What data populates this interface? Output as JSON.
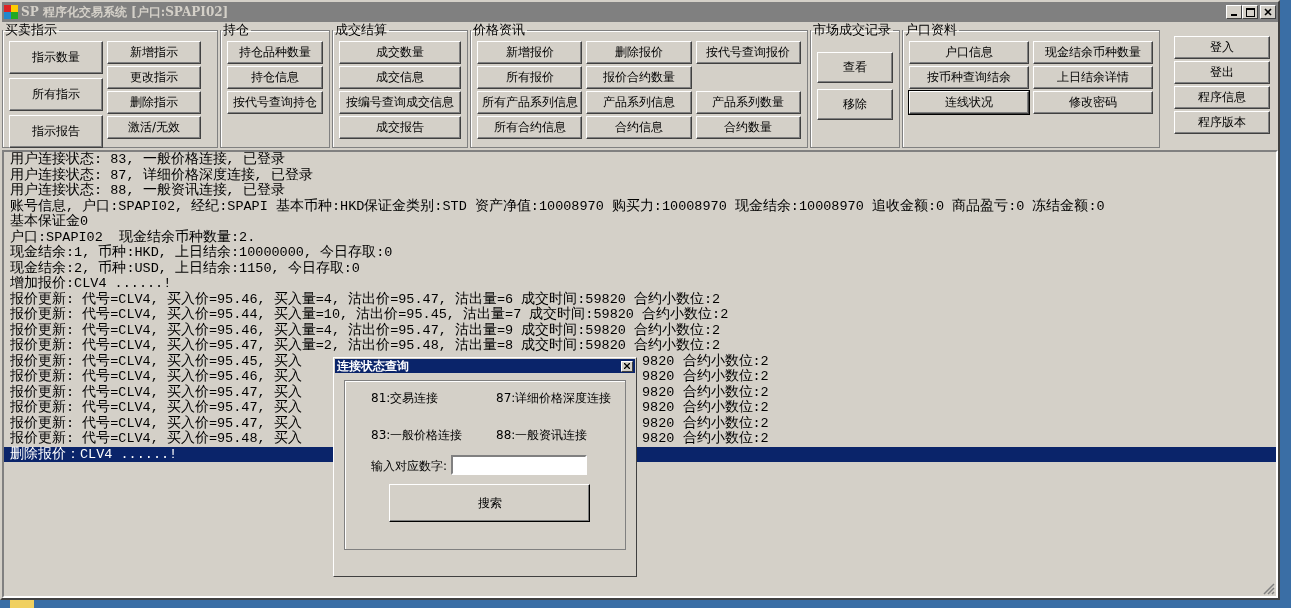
{
  "window": {
    "title": "SP 程序化交易系统 [户口:SPAPI02]"
  },
  "groups": [
    {
      "title": "买卖指示",
      "kind": "columns",
      "columns": [
        [
          {
            "label": "指示数量"
          },
          {
            "label": "所有指示"
          },
          {
            "label": "指示报告"
          }
        ],
        [
          {
            "label": "新增指示"
          },
          {
            "label": "更改指示"
          },
          {
            "label": "删除指示"
          },
          {
            "label": "激活/无效"
          }
        ]
      ]
    },
    {
      "title": "持仓",
      "kind": "rows",
      "rows": [
        [
          {
            "label": "持仓品种数量"
          }
        ],
        [
          {
            "label": "持仓信息"
          }
        ],
        [
          {
            "label": "按代号查询持仓"
          }
        ]
      ]
    },
    {
      "title": "成交结算",
      "kind": "rows",
      "rows": [
        [
          {
            "label": "成交数量"
          }
        ],
        [
          {
            "label": "成交信息"
          }
        ],
        [
          {
            "label": "按编号查询成交信息"
          }
        ],
        [
          {
            "label": "成交报告"
          }
        ]
      ]
    },
    {
      "title": "价格资讯",
      "kind": "rows",
      "rows": [
        [
          {
            "label": "新增报价"
          },
          {
            "label": "删除报价"
          },
          {
            "label": "按代号查询报价"
          }
        ],
        [
          {
            "label": "所有报价"
          },
          {
            "label": "报价合约数量"
          }
        ],
        [
          {
            "label": "所有产品系列信息"
          },
          {
            "label": "产品系列信息"
          },
          {
            "label": "产品系列数量"
          }
        ],
        [
          {
            "label": "所有合约信息"
          },
          {
            "label": "合约信息"
          },
          {
            "label": "合约数量"
          }
        ]
      ]
    },
    {
      "title": "市场成交记录",
      "kind": "tall",
      "rows": [
        [
          {
            "label": "查看"
          }
        ],
        [
          {
            "label": "移除"
          }
        ]
      ]
    },
    {
      "title": "户口资料",
      "kind": "rows",
      "rows": [
        [
          {
            "label": "户口信息",
            "focused": false
          },
          {
            "label": "现金结余币种数量",
            "focused": false
          }
        ],
        [
          {
            "label": "按币种查询结余",
            "focused": false
          },
          {
            "label": "上日结余详情",
            "focused": false
          }
        ],
        [
          {
            "label": "连线状况",
            "focused": true
          },
          {
            "label": "修改密码",
            "focused": false
          }
        ]
      ]
    }
  ],
  "side_buttons": [
    "登入",
    "登出",
    "程序信息",
    "程序版本"
  ],
  "log": [
    {
      "text": "用户连接状态: 83, 一般价格连接, 已登录",
      "selected": false
    },
    {
      "text": "用户连接状态: 87, 详细价格深度连接, 已登录",
      "selected": false
    },
    {
      "text": "用户连接状态: 88, 一般资讯连接, 已登录",
      "selected": false
    },
    {
      "text": "账号信息, 户口:SPAPI02, 经纪:SPAPI 基本币种:HKD保证金类别:STD 资产净值:10008970 购买力:10008970 现金结余:10008970 追收金额:0 商品盈亏:0 冻结金额:0",
      "selected": false
    },
    {
      "text": "基本保证金0",
      "selected": false
    },
    {
      "text": "户口:SPAPI02  现金结余币种数量:2.",
      "selected": false
    },
    {
      "text": "现金结余:1, 币种:HKD, 上日结余:10000000, 今日存取:0",
      "selected": false
    },
    {
      "text": "现金结余:2, 币种:USD, 上日结余:1150, 今日存取:0",
      "selected": false
    },
    {
      "text": "增加报价:CLV4 ......!",
      "selected": false
    },
    {
      "text": "报价更新: 代号=CLV4, 买入价=95.46, 买入量=4, 沽出价=95.47, 沽出量=6 成交时间:59820 合约小数位:2",
      "selected": false
    },
    {
      "text": "报价更新: 代号=CLV4, 买入价=95.44, 买入量=10, 沽出价=95.45, 沽出量=7 成交时间:59820 合约小数位:2",
      "selected": false
    },
    {
      "text": "报价更新: 代号=CLV4, 买入价=95.46, 买入量=4, 沽出价=95.47, 沽出量=9 成交时间:59820 合约小数位:2",
      "selected": false
    },
    {
      "text": "报价更新: 代号=CLV4, 买入价=95.47, 买入量=2, 沽出价=95.48, 沽出量=8 成交时间:59820 合约小数位:2",
      "selected": false
    },
    {
      "text": "报价更新: 代号=CLV4, 买入价=95.45, 买入",
      "tail": "9820 合约小数位:2",
      "selected": false
    },
    {
      "text": "报价更新: 代号=CLV4, 买入价=95.46, 买入",
      "tail": "9820 合约小数位:2",
      "selected": false
    },
    {
      "text": "报价更新: 代号=CLV4, 买入价=95.47, 买入",
      "tail": "9820 合约小数位:2",
      "selected": false
    },
    {
      "text": "报价更新: 代号=CLV4, 买入价=95.47, 买入",
      "tail": "9820 合约小数位:2",
      "selected": false
    },
    {
      "text": "报价更新: 代号=CLV4, 买入价=95.47, 买入",
      "tail": "9820 合约小数位:2",
      "selected": false
    },
    {
      "text": "报价更新: 代号=CLV4, 买入价=95.48, 买入",
      "tail": "9820 合约小数位:2",
      "selected": false
    },
    {
      "text": "删除报价：CLV4 ......!",
      "selected": true
    }
  ],
  "dialog": {
    "title": "连接状态查询",
    "options": [
      "81:交易连接",
      "87:详细价格深度连接",
      "83:一般价格连接",
      "88:一般资讯连接"
    ],
    "input_label": "输入对应数字:",
    "search_button": "搜索"
  }
}
